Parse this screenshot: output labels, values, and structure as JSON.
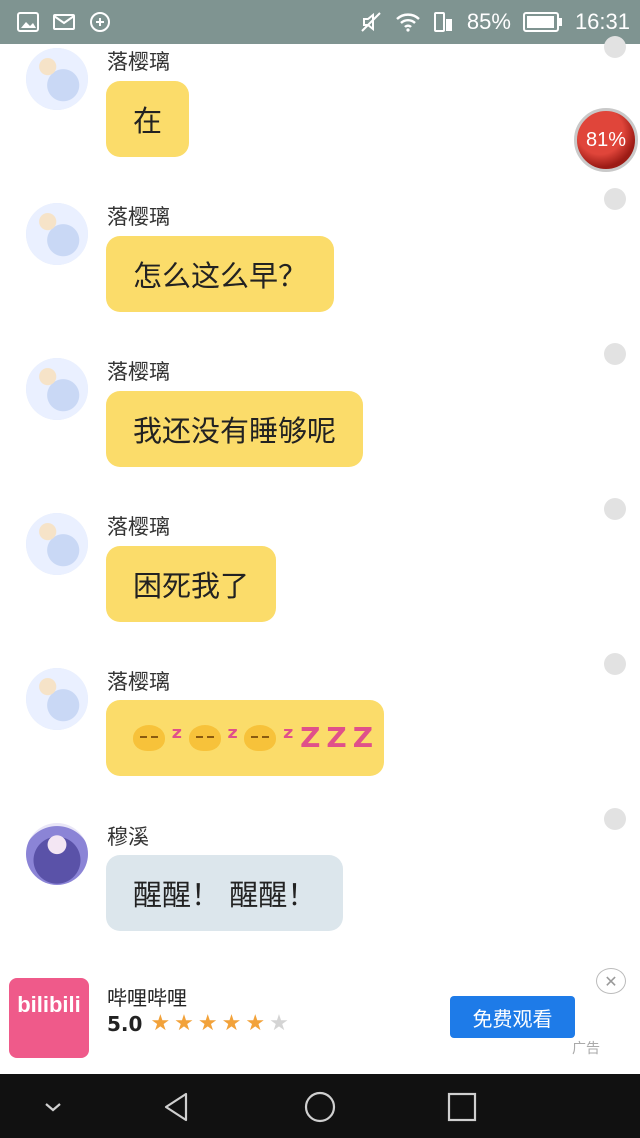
{
  "status_bar": {
    "battery_text": "85%",
    "time": "16:31"
  },
  "floating_badge": {
    "text": "81%"
  },
  "messages": [
    {
      "sender": "落樱璃",
      "text": "在"
    },
    {
      "sender": "落樱璃",
      "text": "怎么这么早？"
    },
    {
      "sender": "落樱璃",
      "text": "我还没有睡够呢"
    },
    {
      "sender": "落樱璃",
      "text": "困死我了"
    },
    {
      "sender": "落樱璃",
      "text": ""
    },
    {
      "sender": "穆溪",
      "text": "醒醒！ 醒醒！"
    }
  ],
  "ad": {
    "logo_text": "bilibili",
    "title": "哔哩哔哩",
    "rating": "5.0",
    "rating_stars": 4.5,
    "button_label": "免费观看",
    "label": "广告"
  },
  "colors": {
    "status_bar": "#7f9491",
    "bubble_incoming": "#fbdc6a",
    "bubble_gray": "#dce6ec",
    "ad_button": "#1e7be8",
    "nav_bar": "#111111"
  }
}
